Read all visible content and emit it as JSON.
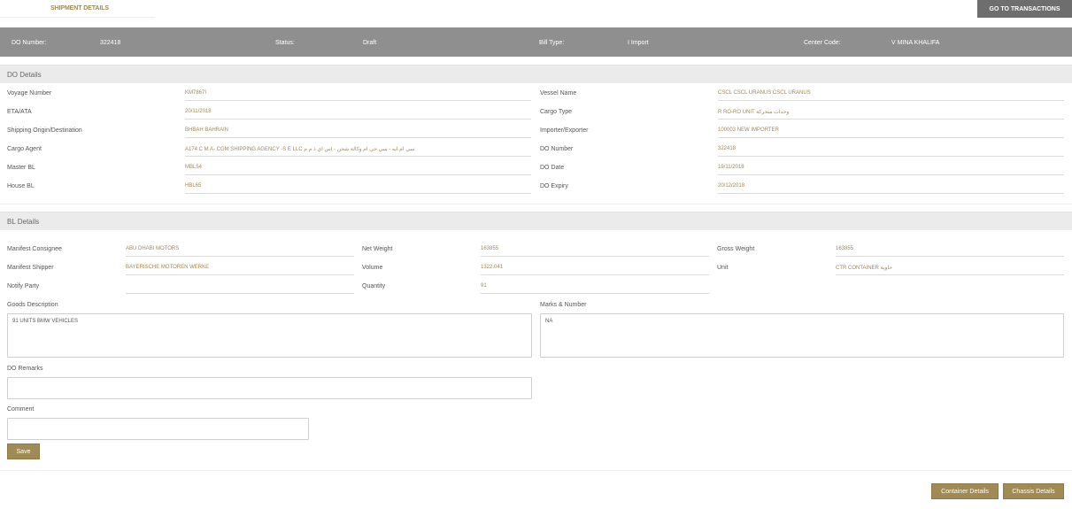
{
  "header": {
    "tab_title": "SHIPMENT DETAILS",
    "goto_button": "GO TO TRANSACTIONS"
  },
  "summary": {
    "do_number_label": "DO Number:",
    "do_number_value": "322418",
    "status_label": "Status:",
    "status_value": "Draft",
    "bill_type_label": "Bill Type:",
    "bill_type_value": "I Import",
    "center_code_label": "Center Code:",
    "center_code_value": "V MINA KHALIFA"
  },
  "do_details": {
    "title": "DO Details",
    "left": [
      {
        "label": "Voyage Number",
        "value": "KM7867I"
      },
      {
        "label": "ETA/ATA",
        "value": "20/11/2018"
      },
      {
        "label": "Shipping Origin/Destination",
        "value": "BHBAH BAHRAIN"
      },
      {
        "label": "Cargo Agent",
        "value": "A174 C M A- CGM SHIPPING AGENCY -S E LLC سي ام ايه - سي جي ام وكالة شحن - اس اي ذ م م"
      },
      {
        "label": "Master BL",
        "value": "MBL54"
      },
      {
        "label": "House BL",
        "value": "HBL65"
      }
    ],
    "right": [
      {
        "label": "Vessel Name",
        "value": "CSCL CSCL URANUS  CSCL URANUS"
      },
      {
        "label": "Cargo Type",
        "value": "R RO-RO UNIT وحدات متحركة"
      },
      {
        "label": "Importer/Exporter",
        "value": "100003 NEW IMPORTER"
      },
      {
        "label": "DO Number",
        "value": "322418"
      },
      {
        "label": "DO Date",
        "value": "19/11/2018"
      },
      {
        "label": "DO Expiry",
        "value": "20/12/2018"
      }
    ]
  },
  "bl_details": {
    "title": "BL Details",
    "col1": [
      {
        "label": "Manifest Consignee",
        "value": "ABU DHABI MOTORS"
      },
      {
        "label": "Manifest Shipper",
        "value": "BAYERISCHE MOTOREN WERKE"
      },
      {
        "label": "Notify Party",
        "value": ""
      }
    ],
    "col2": [
      {
        "label": "Net Weight",
        "value": "163855"
      },
      {
        "label": "Volume",
        "value": "1322.041"
      },
      {
        "label": "Quantity",
        "value": "91"
      }
    ],
    "col3": [
      {
        "label": "Gross Weight",
        "value": "163855"
      },
      {
        "label": "Unit",
        "value": "CTR CONTAINER حاوية"
      }
    ],
    "goods_description_label": "Goods Description",
    "goods_description_value": "91 UNITS BMW VEHICLES",
    "marks_label": "Marks & Number",
    "marks_value": "NA",
    "do_remarks_label": "DO Remarks",
    "do_remarks_value": "",
    "comment_label": "Comment",
    "comment_value": ""
  },
  "actions": {
    "save": "Save",
    "container_details": "Container Details",
    "chassis_details": "Chassis Details"
  },
  "colors": {
    "accent": "#a08a55",
    "summary_bar": "#8f8f8f",
    "goto_button": "#6e6e6e",
    "section_header": "#ebebeb"
  }
}
